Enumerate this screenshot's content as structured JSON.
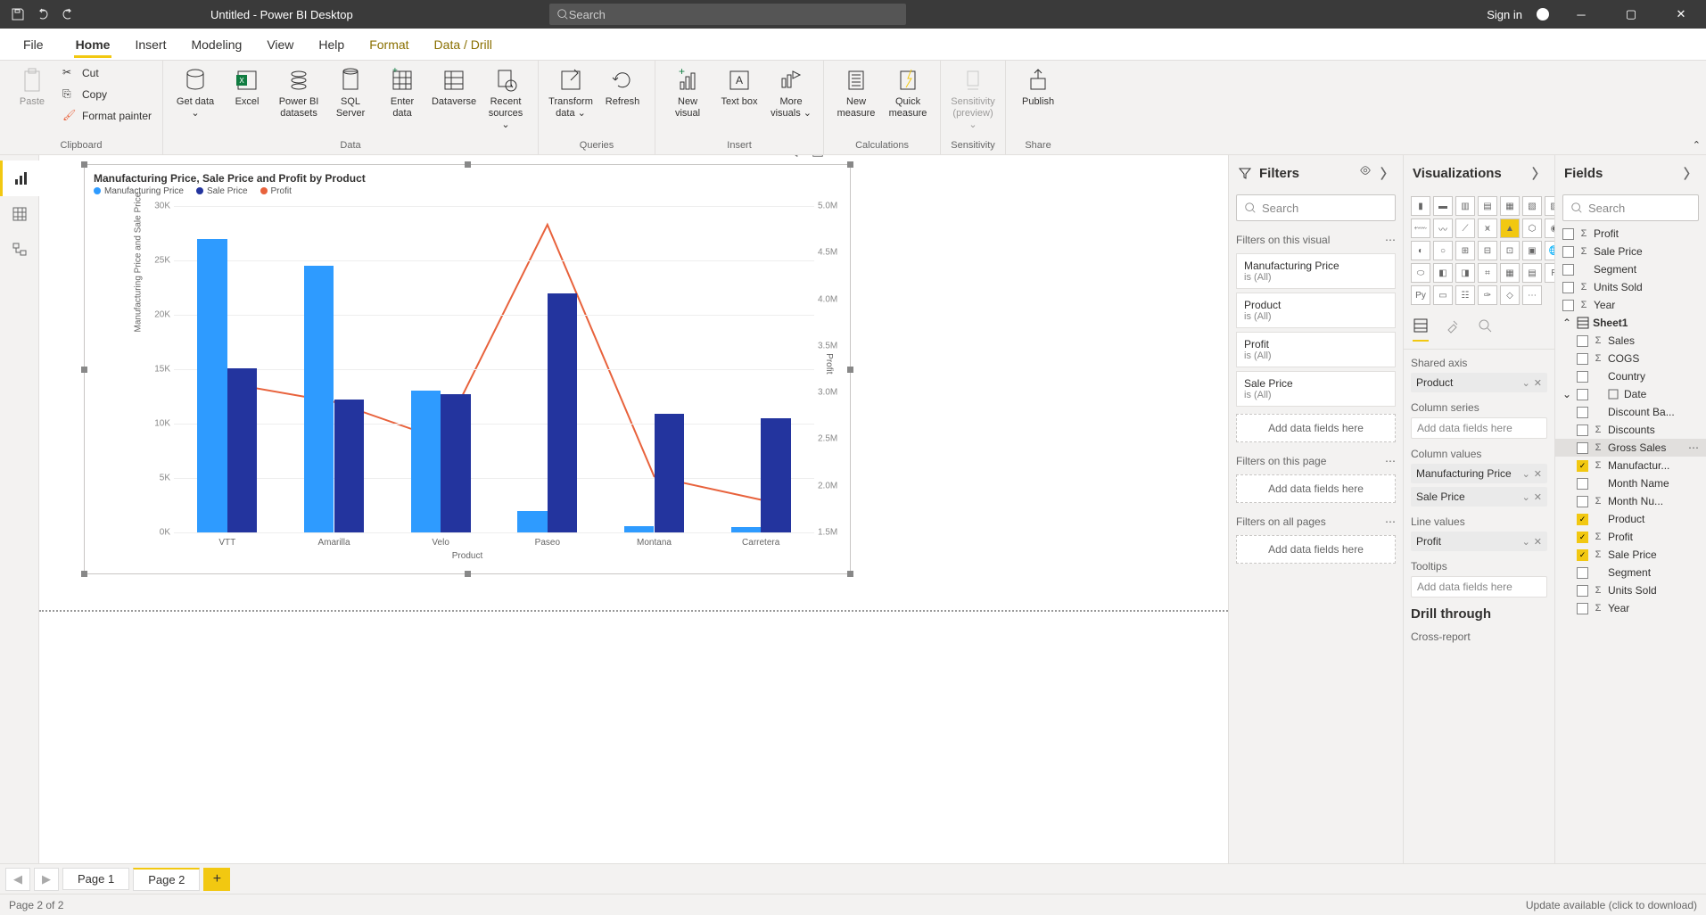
{
  "title": "Untitled - Power BI Desktop",
  "search_placeholder": "Search",
  "signin": "Sign in",
  "tabs": {
    "file": "File",
    "home": "Home",
    "insert": "Insert",
    "modeling": "Modeling",
    "view": "View",
    "help": "Help",
    "format": "Format",
    "datadrill": "Data / Drill"
  },
  "ribbon": {
    "clipboard": {
      "paste": "Paste",
      "cut": "Cut",
      "copy": "Copy",
      "fp": "Format painter",
      "group": "Clipboard"
    },
    "data": {
      "getdata": "Get data",
      "excel": "Excel",
      "pbids": "Power BI datasets",
      "sql": "SQL Server",
      "enter": "Enter data",
      "dataverse": "Dataverse",
      "recent": "Recent sources",
      "group": "Data"
    },
    "queries": {
      "transform": "Transform data",
      "refresh": "Refresh",
      "group": "Queries"
    },
    "insert": {
      "newvis": "New visual",
      "textbox": "Text box",
      "more": "More visuals",
      "group": "Insert"
    },
    "calc": {
      "newmeasure": "New measure",
      "quick": "Quick measure",
      "group": "Calculations"
    },
    "sens": {
      "sens": "Sensitivity (preview)",
      "group": "Sensitivity"
    },
    "share": {
      "publish": "Publish",
      "group": "Share"
    }
  },
  "filters": {
    "title": "Filters",
    "search": "Search",
    "on_visual": "Filters on this visual",
    "on_page": "Filters on this page",
    "on_all": "Filters on all pages",
    "add": "Add data fields here",
    "cards": [
      {
        "name": "Manufacturing Price",
        "sub": "is (All)"
      },
      {
        "name": "Product",
        "sub": "is (All)"
      },
      {
        "name": "Profit",
        "sub": "is (All)"
      },
      {
        "name": "Sale Price",
        "sub": "is (All)"
      }
    ]
  },
  "viz": {
    "title": "Visualizations",
    "wells": {
      "shared_axis": "Shared axis",
      "column_series": "Column series",
      "column_values": "Column values",
      "line_values": "Line values",
      "tooltips": "Tooltips",
      "drill": "Drill through",
      "cross": "Cross-report"
    },
    "items": {
      "product": "Product",
      "mfg": "Manufacturing Price",
      "sale": "Sale Price",
      "profit": "Profit",
      "empty": "Add data fields here"
    }
  },
  "fields": {
    "title": "Fields",
    "search": "Search",
    "top": [
      {
        "name": "Profit",
        "sigma": true
      },
      {
        "name": "Sale Price",
        "sigma": true
      },
      {
        "name": "Segment",
        "sigma": false
      },
      {
        "name": "Units Sold",
        "sigma": true
      },
      {
        "name": "Year",
        "sigma": true
      }
    ],
    "sheet": "Sheet1",
    "list": [
      {
        "name": "Sales",
        "sigma": true,
        "chk": false
      },
      {
        "name": "COGS",
        "sigma": true,
        "chk": false
      },
      {
        "name": "Country",
        "sigma": false,
        "chk": false
      },
      {
        "name": "Date",
        "sigma": false,
        "chk": false,
        "table": true
      },
      {
        "name": "Discount Ba...",
        "sigma": false,
        "chk": false
      },
      {
        "name": "Discounts",
        "sigma": true,
        "chk": false
      },
      {
        "name": "Gross Sales",
        "sigma": true,
        "chk": false,
        "sel": true
      },
      {
        "name": "Manufactur...",
        "sigma": true,
        "chk": true
      },
      {
        "name": "Month Name",
        "sigma": false,
        "chk": false
      },
      {
        "name": "Month Nu...",
        "sigma": true,
        "chk": false
      },
      {
        "name": "Product",
        "sigma": false,
        "chk": true
      },
      {
        "name": "Profit",
        "sigma": true,
        "chk": true
      },
      {
        "name": "Sale Price",
        "sigma": true,
        "chk": true
      },
      {
        "name": "Segment",
        "sigma": false,
        "chk": false
      },
      {
        "name": "Units Sold",
        "sigma": true,
        "chk": false
      },
      {
        "name": "Year",
        "sigma": true,
        "chk": false
      }
    ]
  },
  "pages": {
    "p1": "Page 1",
    "p2": "Page 2"
  },
  "status": {
    "left": "Page 2 of 2",
    "right": "Update available (click to download)"
  },
  "chart_data": {
    "type": "bar+line-combo",
    "title": "Manufacturing Price, Sale Price and Profit by Product",
    "xlabel": "Product",
    "ylabel": "Manufacturing Price and Sale Price",
    "y2label": "Profit",
    "categories": [
      "VTT",
      "Amarilla",
      "Velo",
      "Paseo",
      "Montana",
      "Carretera"
    ],
    "series": [
      {
        "name": "Manufacturing Price",
        "color": "#2e9bff",
        "values": [
          27000,
          24500,
          13000,
          2000,
          600,
          500
        ]
      },
      {
        "name": "Sale Price",
        "color": "#23349e",
        "values": [
          15100,
          12200,
          12700,
          22000,
          10900,
          10500
        ]
      }
    ],
    "line": {
      "name": "Profit",
      "color": "#e8623c",
      "values": [
        3100000,
        2900000,
        2500000,
        4800000,
        2100000,
        1850000
      ]
    },
    "ylim": [
      0,
      30000
    ],
    "y_ticks": [
      0,
      5000,
      10000,
      15000,
      20000,
      25000,
      30000
    ],
    "y_tick_labels": [
      "0K",
      "5K",
      "10K",
      "15K",
      "20K",
      "25K",
      "30K"
    ],
    "y2lim": [
      1500000,
      5000000
    ],
    "y2_ticks": [
      1500000,
      2000000,
      2500000,
      3000000,
      3500000,
      4000000,
      4500000,
      5000000
    ],
    "y2_tick_labels": [
      "1.5M",
      "2.0M",
      "2.5M",
      "3.0M",
      "3.5M",
      "4.0M",
      "4.5M",
      "5.0M"
    ]
  }
}
